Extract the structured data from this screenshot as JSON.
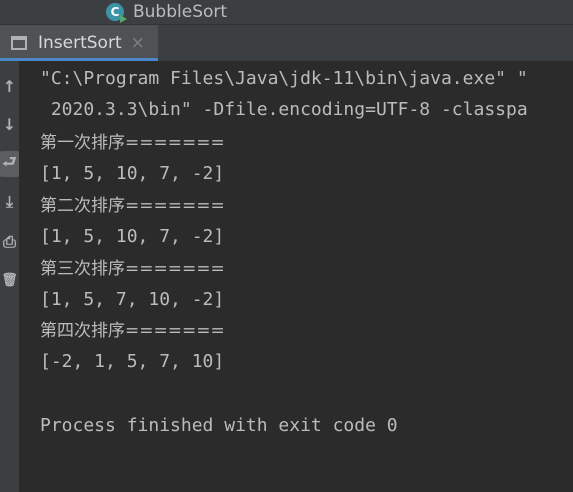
{
  "editor_tab": {
    "label": "BubbleSort",
    "icon_letter": "C"
  },
  "run_window": {
    "tab_label": "InsertSort",
    "close_glyph": "×"
  },
  "side_toolbar": {
    "up_glyph": "↑",
    "down_glyph": "↓",
    "wrap_glyph": "⮐",
    "scroll_end_glyph": "⤓",
    "print_glyph": "⎙",
    "trash_glyph": "🗑"
  },
  "console": {
    "lines": [
      "\"C:\\Program Files\\Java\\jdk-11\\bin\\java.exe\" \"",
      " 2020.3.3\\bin\" -Dfile.encoding=UTF-8 -classpa",
      "第一次排序=======",
      "[1, 5, 10, 7, -2]",
      "第二次排序=======",
      "[1, 5, 10, 7, -2]",
      "第三次排序=======",
      "[1, 5, 7, 10, -2]",
      "第四次排序=======",
      "[-2, 1, 5, 7, 10]",
      "",
      "Process finished with exit code 0"
    ]
  },
  "colors": {
    "console_bg": "#2b2b2b",
    "toolbar_bg": "#3c3f41",
    "active_tab_bg": "#4e5254",
    "active_tab_underline": "#4a88c7",
    "text": "#bbbbbb",
    "class_icon": "#3b93a8"
  }
}
